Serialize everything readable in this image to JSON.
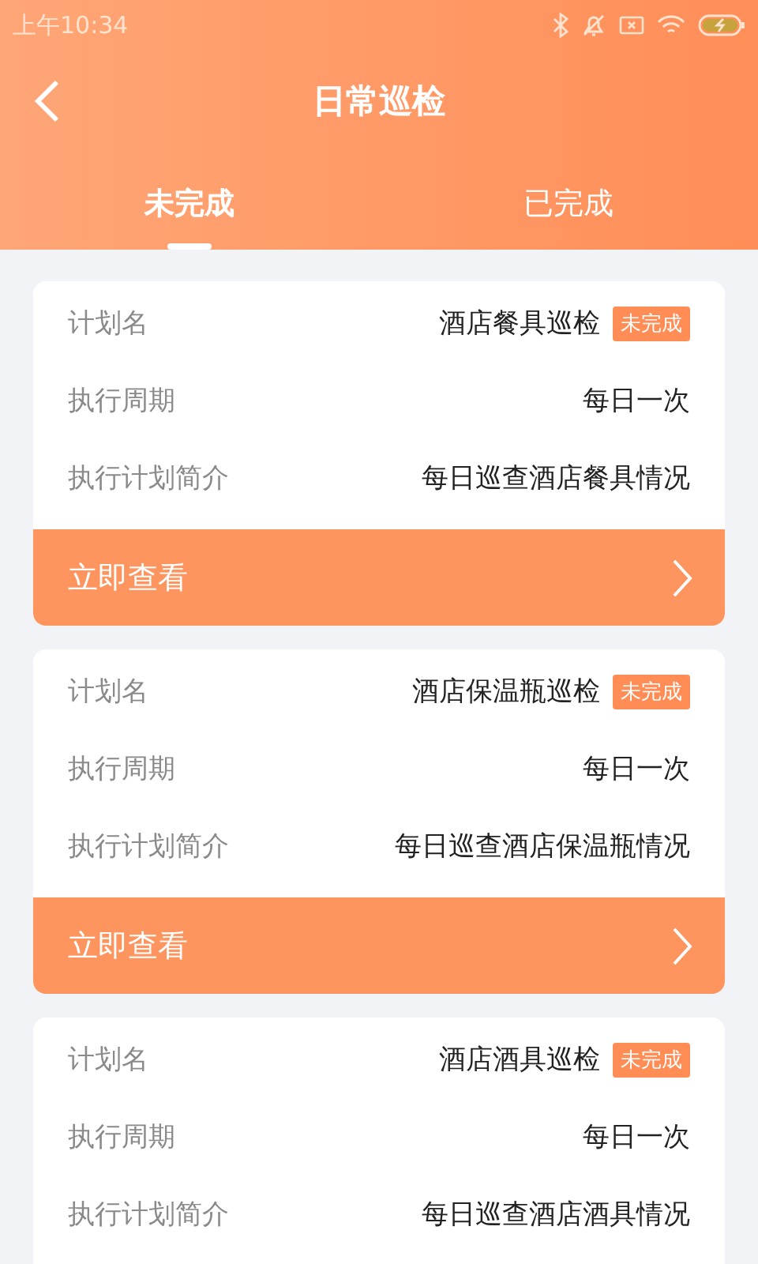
{
  "status_bar": {
    "time": "上午10:34"
  },
  "header": {
    "title": "日常巡检"
  },
  "tabs": [
    {
      "label": "未完成",
      "selected": true
    },
    {
      "label": "已完成",
      "selected": false
    }
  ],
  "plans": [
    {
      "rows": [
        {
          "label": "计划名",
          "value": "酒店餐具巡检",
          "badge": "未完成"
        },
        {
          "label": "执行周期",
          "value": "每日一次"
        },
        {
          "label": "执行计划简介",
          "value": "每日巡查酒店餐具情况"
        }
      ],
      "action": "立即查看"
    },
    {
      "rows": [
        {
          "label": "计划名",
          "value": "酒店保温瓶巡检",
          "badge": "未完成"
        },
        {
          "label": "执行周期",
          "value": "每日一次"
        },
        {
          "label": "执行计划简介",
          "value": "每日巡查酒店保温瓶情况"
        }
      ],
      "action": "立即查看"
    },
    {
      "rows": [
        {
          "label": "计划名",
          "value": "酒店酒具巡检",
          "badge": "未完成"
        },
        {
          "label": "执行周期",
          "value": "每日一次"
        },
        {
          "label": "执行计划简介",
          "value": "每日巡查酒店酒具情况"
        }
      ]
    }
  ]
}
